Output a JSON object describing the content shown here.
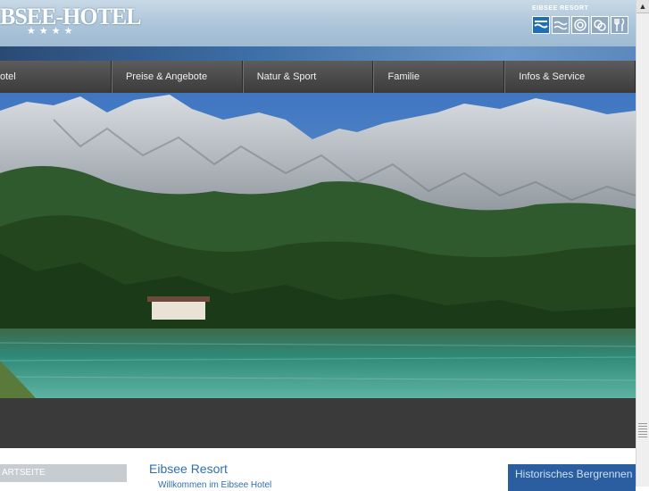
{
  "header": {
    "logo_text": "BSEE-HOTEL",
    "stars": "★★★★",
    "resort_label": "EIBSEE RESORT",
    "resort_icons": [
      "wave-logo-icon",
      "lake-icon",
      "circle-icon",
      "rings-icon",
      "cutlery-icon"
    ]
  },
  "nav": {
    "items": [
      {
        "label": "otel"
      },
      {
        "label": "Preise & Angebote"
      },
      {
        "label": "Natur & Sport"
      },
      {
        "label": "Familie"
      },
      {
        "label": "Infos & Service"
      }
    ]
  },
  "sidebar": {
    "heading": "ARTSEITE"
  },
  "main": {
    "title": "Eibsee Resort",
    "link": "Willkommen im Eibsee Hotel"
  },
  "promo": {
    "text": "Historisches Bergrennen um den Zugspitz-Cup"
  },
  "colors": {
    "nav_bg": "#4a4a4a",
    "accent_blue": "#2f6fb0",
    "header_bg": "#b4cade"
  }
}
